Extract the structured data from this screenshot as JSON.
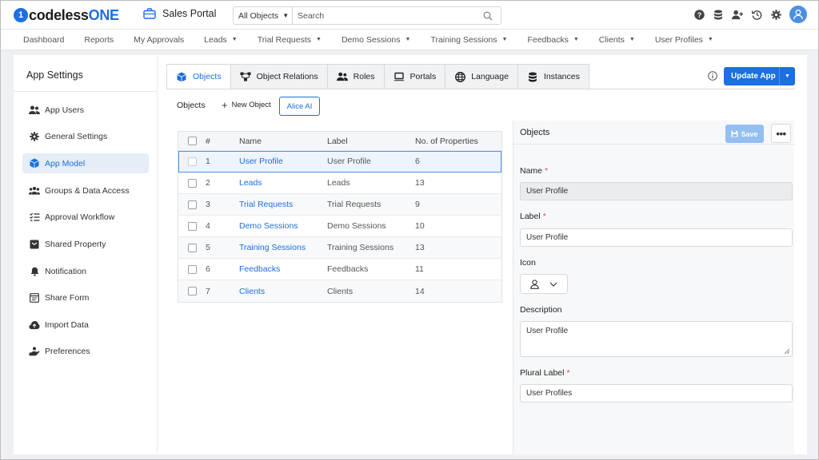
{
  "app": {
    "logo_prefix": "codeless",
    "logo_suffix": "ONE",
    "logo_mark": "1",
    "portal_name": "Sales Portal",
    "portal_icon": "briefcase-icon"
  },
  "search": {
    "scope": "All Objects",
    "placeholder": "Search"
  },
  "top_icons": [
    "help-icon",
    "database-icon",
    "add-user-icon",
    "history-icon",
    "settings-icon",
    "user-avatar"
  ],
  "nav": [
    {
      "label": "Dashboard",
      "dropdown": false
    },
    {
      "label": "Reports",
      "dropdown": false
    },
    {
      "label": "My Approvals",
      "dropdown": false
    },
    {
      "label": "Leads",
      "dropdown": true
    },
    {
      "label": "Trial Requests",
      "dropdown": true
    },
    {
      "label": "Demo Sessions",
      "dropdown": true
    },
    {
      "label": "Training Sessions",
      "dropdown": true
    },
    {
      "label": "Feedbacks",
      "dropdown": true
    },
    {
      "label": "Clients",
      "dropdown": true
    },
    {
      "label": "User Profiles",
      "dropdown": true
    }
  ],
  "sidebar": {
    "title": "App Settings",
    "items": [
      {
        "label": "App Users",
        "icon": "users-icon"
      },
      {
        "label": "General Settings",
        "icon": "gear-icon"
      },
      {
        "label": "App Model",
        "icon": "cube-icon",
        "active": true
      },
      {
        "label": "Groups & Data Access",
        "icon": "group-icon"
      },
      {
        "label": "Approval Workflow",
        "icon": "checklist-icon"
      },
      {
        "label": "Shared Property",
        "icon": "shared-property-icon"
      },
      {
        "label": "Notification",
        "icon": "bell-icon"
      },
      {
        "label": "Share Form",
        "icon": "form-icon"
      },
      {
        "label": "Import Data",
        "icon": "cloud-upload-icon"
      },
      {
        "label": "Preferences",
        "icon": "preferences-icon"
      }
    ]
  },
  "tabs": [
    {
      "label": "Objects",
      "icon": "cube-icon",
      "active": true
    },
    {
      "label": "Object Relations",
      "icon": "relations-icon"
    },
    {
      "label": "Roles",
      "icon": "roles-icon"
    },
    {
      "label": "Portals",
      "icon": "laptop-icon"
    },
    {
      "label": "Language",
      "icon": "globe-icon"
    },
    {
      "label": "Instances",
      "icon": "database-icon"
    }
  ],
  "toolbar": {
    "update_label": "Update App",
    "section_title": "Objects",
    "new_object_label": "New Object",
    "alice_label": "Alice AI"
  },
  "table": {
    "headers": [
      "#",
      "Name",
      "Label",
      "No. of Properties"
    ],
    "rows": [
      {
        "num": "1",
        "name": "User Profile",
        "label": "User Profile",
        "props": "6",
        "selected": true
      },
      {
        "num": "2",
        "name": "Leads",
        "label": "Leads",
        "props": "13"
      },
      {
        "num": "3",
        "name": "Trial Requests",
        "label": "Trial Requests",
        "props": "9"
      },
      {
        "num": "4",
        "name": "Demo Sessions",
        "label": "Demo Sessions",
        "props": "10"
      },
      {
        "num": "5",
        "name": "Training Sessions",
        "label": "Training Sessions",
        "props": "13"
      },
      {
        "num": "6",
        "name": "Feedbacks",
        "label": "Feedbacks",
        "props": "11"
      },
      {
        "num": "7",
        "name": "Clients",
        "label": "Clients",
        "props": "14"
      }
    ]
  },
  "detail": {
    "title": "Objects",
    "save_label": "Save",
    "more_label": "•••",
    "name_label": "Name",
    "name_value": "User Profile",
    "label_label": "Label",
    "label_value": "User Profile",
    "icon_label": "Icon",
    "icon_value": "user-icon",
    "description_label": "Description",
    "description_value": "User Profile",
    "plural_label": "Plural Label",
    "plural_value": "User Profiles",
    "required_mark": "*"
  },
  "colors": {
    "accent": "#1b6fe0",
    "active_bg": "#e6edf7",
    "required": "#e04b4b",
    "save_disabled": "#93bff2"
  }
}
